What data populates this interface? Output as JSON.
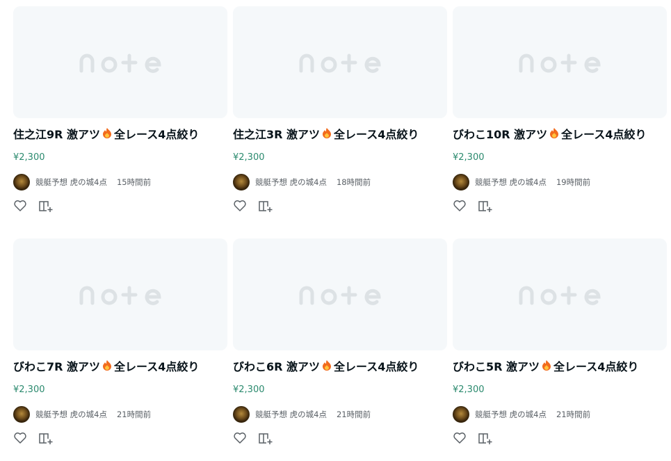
{
  "cards": [
    {
      "title": "住之江9R 激アツ",
      "title_suffix": "全レース4点絞り",
      "price": "¥2,300",
      "author": "競艇予想 虎の城4点",
      "time": "15時間前"
    },
    {
      "title": "住之江3R 激アツ",
      "title_suffix": "全レース4点絞り",
      "price": "¥2,300",
      "author": "競艇予想 虎の城4点",
      "time": "18時間前"
    },
    {
      "title": "びわこ10R 激アツ",
      "title_suffix": "全レース4点絞り",
      "price": "¥2,300",
      "author": "競艇予想 虎の城4点",
      "time": "19時間前"
    },
    {
      "title": "びわこ7R 激アツ",
      "title_suffix": "全レース4点絞り",
      "price": "¥2,300",
      "author": "競艇予想 虎の城4点",
      "time": "21時間前"
    },
    {
      "title": "びわこ6R 激アツ",
      "title_suffix": "全レース4点絞り",
      "price": "¥2,300",
      "author": "競艇予想 虎の城4点",
      "time": "21時間前"
    },
    {
      "title": "びわこ5R 激アツ",
      "title_suffix": "全レース4点絞り",
      "price": "¥2,300",
      "author": "競艇予想 虎の城4点",
      "time": "21時間前"
    }
  ],
  "icons": {
    "placeholder": "note-logo-placeholder",
    "emoji": "fire-icon",
    "like": "heart-icon",
    "save": "magazine-add-icon"
  },
  "colors": {
    "price": "#2b8a6e",
    "thumb_bg": "#f5f8fa",
    "logo": "#dde2e5"
  }
}
